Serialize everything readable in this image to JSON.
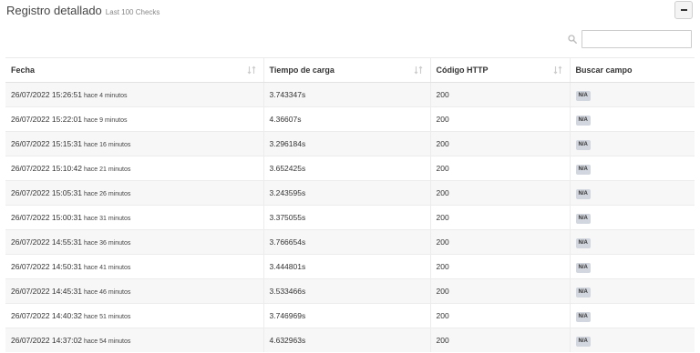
{
  "header": {
    "title": "Registro detallado",
    "subtitle": "Last 100 Checks"
  },
  "toolbar": {
    "collapse_icon": "minus-icon",
    "search_icon": "search-icon",
    "search_value": "",
    "search_placeholder": ""
  },
  "table": {
    "columns": [
      {
        "label": "Fecha",
        "sortable": true
      },
      {
        "label": "Tiempo de carga",
        "sortable": true
      },
      {
        "label": "Código HTTP",
        "sortable": true
      },
      {
        "label": "Buscar campo",
        "sortable": false
      }
    ],
    "rows": [
      {
        "date": "26/07/2022 15:26:51",
        "ago": "hace 4 minutos",
        "load": "3.743347s",
        "code": "200",
        "field": "N/A"
      },
      {
        "date": "26/07/2022 15:22:01",
        "ago": "hace 9 minutos",
        "load": "4.36607s",
        "code": "200",
        "field": "N/A"
      },
      {
        "date": "26/07/2022 15:15:31",
        "ago": "hace 16 minutos",
        "load": "3.296184s",
        "code": "200",
        "field": "N/A"
      },
      {
        "date": "26/07/2022 15:10:42",
        "ago": "hace 21 minutos",
        "load": "3.652425s",
        "code": "200",
        "field": "N/A"
      },
      {
        "date": "26/07/2022 15:05:31",
        "ago": "hace 26 minutos",
        "load": "3.243595s",
        "code": "200",
        "field": "N/A"
      },
      {
        "date": "26/07/2022 15:00:31",
        "ago": "hace 31 minutos",
        "load": "3.375055s",
        "code": "200",
        "field": "N/A"
      },
      {
        "date": "26/07/2022 14:55:31",
        "ago": "hace 36 minutos",
        "load": "3.766654s",
        "code": "200",
        "field": "N/A"
      },
      {
        "date": "26/07/2022 14:50:31",
        "ago": "hace 41 minutos",
        "load": "3.444801s",
        "code": "200",
        "field": "N/A"
      },
      {
        "date": "26/07/2022 14:45:31",
        "ago": "hace 46 minutos",
        "load": "3.533466s",
        "code": "200",
        "field": "N/A"
      },
      {
        "date": "26/07/2022 14:40:32",
        "ago": "hace 51 minutos",
        "load": "3.746969s",
        "code": "200",
        "field": "N/A"
      },
      {
        "date": "26/07/2022 14:37:02",
        "ago": "hace 54 minutos",
        "load": "4.632963s",
        "code": "200",
        "field": "N/A"
      }
    ]
  },
  "colors": {
    "badge_bg": "#d2d6de",
    "stripe": "#f7f7f7",
    "border": "#ececec"
  }
}
